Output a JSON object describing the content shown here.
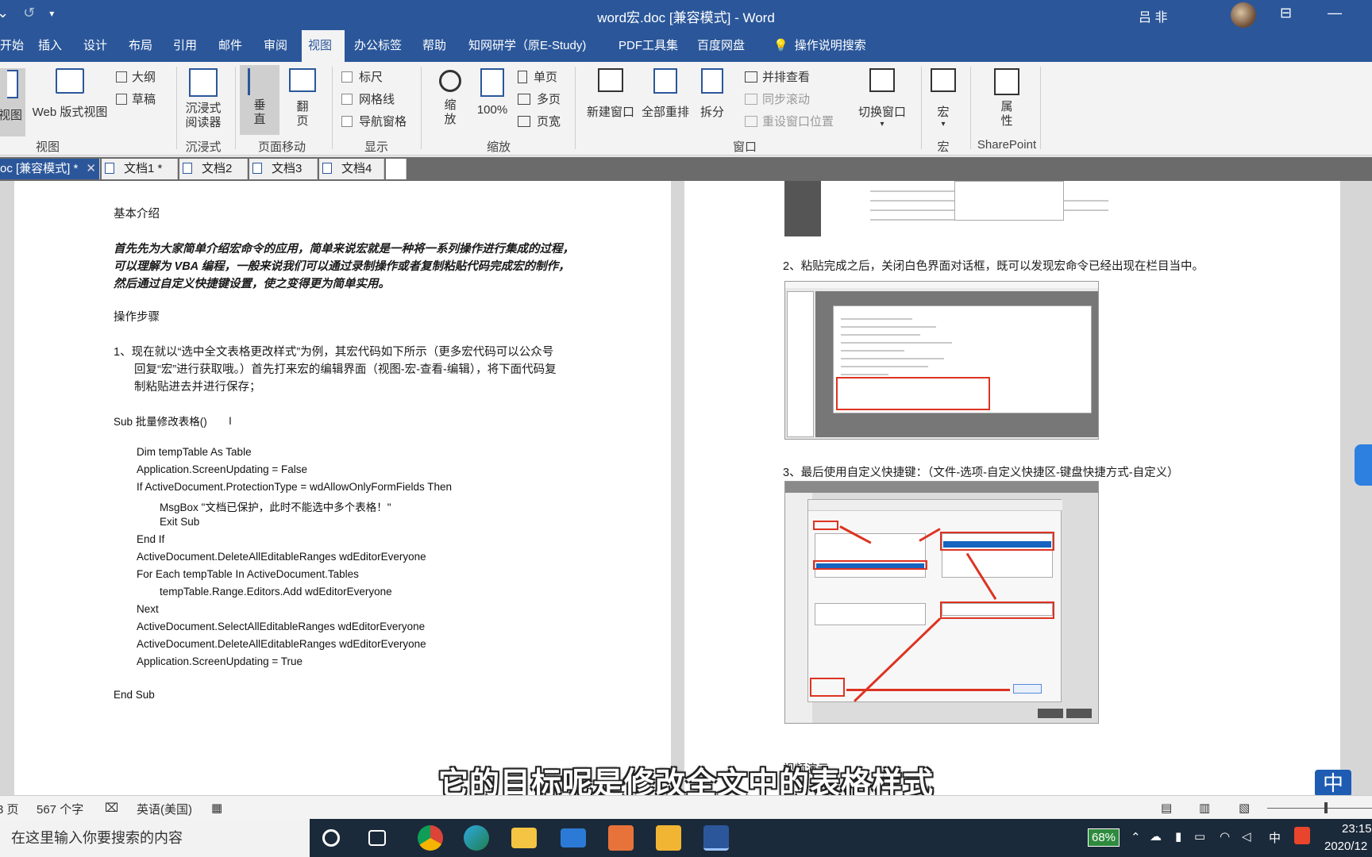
{
  "window": {
    "title": "word宏.doc [兼容模式] - Word",
    "user_name": "吕 非"
  },
  "ribbon_tabs": [
    "开始",
    "插入",
    "设计",
    "布局",
    "引用",
    "邮件",
    "审阅",
    "视图",
    "办公标签",
    "帮助",
    "知网研学（原E-Study)",
    "PDF工具集",
    "百度网盘",
    "操作说明搜索"
  ],
  "active_tab": "视图",
  "ribbon": {
    "view_group": {
      "read_mode": "视图",
      "web_layout": "Web 版式视图",
      "outline": "大纲",
      "draft": "草稿",
      "label": "视图"
    },
    "immersive_group": {
      "reader": "沉浸式\n阅读器",
      "label": "沉浸式"
    },
    "page_move_group": {
      "vertical": "垂\n直",
      "side": "翻\n页",
      "label": "页面移动"
    },
    "show_group": {
      "ruler": "标尺",
      "gridlines": "网格线",
      "nav_pane": "导航窗格",
      "label": "显示"
    },
    "zoom_group": {
      "zoom": "缩\n放",
      "hundred": "100%",
      "one_page": "单页",
      "multi_page": "多页",
      "page_width": "页宽",
      "label": "缩放"
    },
    "window_group": {
      "new_window": "新建窗口",
      "arrange_all": "全部重排",
      "split": "拆分",
      "side_by_side": "并排查看",
      "sync_scroll": "同步滚动",
      "reset_pos": "重设窗口位置",
      "switch_window": "切换窗口",
      "label": "窗口"
    },
    "macro_group": {
      "macro": "宏",
      "label": "宏"
    },
    "sharepoint_group": {
      "properties": "属\n性",
      "label": "SharePoint"
    }
  },
  "doc_tabs": [
    "oc [兼容模式] *",
    "文档1 *",
    "文档2",
    "文档3",
    "文档4"
  ],
  "left_page": {
    "intro_title": "基本介绍",
    "intro_lines": [
      "首先先为大家简单介绍宏命令的应用，简单来说宏就是一种将一系列操作进行集成的过程，",
      "可以理解为 VBA 编程，一般来说我们可以通过录制操作或者复制粘贴代码完成宏的制作，",
      "然后通过自定义快捷键设置，使之变得更为简单实用。"
    ],
    "steps_title": "操作步骤",
    "step1_lines": [
      "1、现在就以“选中全文表格更改样式”为例，其宏代码如下所示（更多宏代码可以公众号",
      "回复“宏”进行获取哦。）首先打来宏的编辑界面（视图-宏-查看-编辑），将下面代码复",
      "制粘贴进去并进行保存；"
    ],
    "code_lines": [
      "Sub  批量修改表格()",
      "Dim tempTable As Table",
      "Application.ScreenUpdating = False",
      "If ActiveDocument.ProtectionType = wdAllowOnlyFormFields Then",
      "MsgBox \"文档已保护，此时不能选中多个表格！\"",
      "Exit Sub",
      "End If",
      "ActiveDocument.DeleteAllEditableRanges wdEditorEveryone",
      "For Each tempTable In ActiveDocument.Tables",
      "tempTable.Range.Editors.Add wdEditorEveryone",
      "Next",
      "ActiveDocument.SelectAllEditableRanges wdEditorEveryone",
      "ActiveDocument.DeleteAllEditableRanges wdEditorEveryone",
      "Application.ScreenUpdating = True",
      "End Sub"
    ]
  },
  "right_page": {
    "step2": "2、粘贴完成之后，关闭白色界面对话框，既可以发现宏命令已经出现在栏目当中。",
    "step3": "3、最后使用自定义快捷键：（文件-选项-自定义快捷区-键盘快捷方式-自定义）",
    "video_title": "视频演示"
  },
  "subtitle": "它的目标呢是修改全文中的表格样式",
  "ime_badge": "中",
  "status_bar": {
    "page": "3 页",
    "word_count": "567 个字",
    "language": "英语(美国)"
  },
  "taskbar": {
    "search_placeholder": "在这里输入你要搜索的内容",
    "battery": "68%",
    "ime": "中",
    "time": "23:15",
    "date": "2020/12"
  },
  "colors": {
    "word_blue": "#2b579a",
    "taskbar": "#1b2a3a",
    "annotation_red": "#d32"
  }
}
